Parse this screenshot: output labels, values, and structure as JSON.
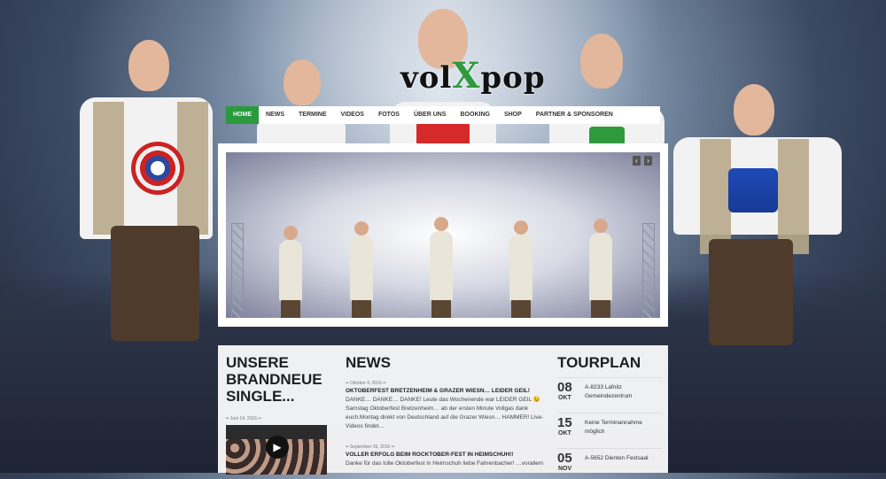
{
  "brand": {
    "logo_text_1": "vol",
    "logo_text_2": "X",
    "logo_text_3": "pop"
  },
  "nav": {
    "items": [
      "HOME",
      "NEWS",
      "TERMINE",
      "VIDEOS",
      "FOTOS",
      "ÜBER UNS",
      "BOOKING",
      "SHOP",
      "PARTNER & SPONSOREN"
    ],
    "active_index": 0
  },
  "slider": {
    "prev_label": "‹",
    "next_label": "›"
  },
  "single": {
    "title": "UNSERE BRANDNEUE SINGLE...",
    "date": "•• Juni 14, 2016 ••",
    "play_icon": "play-icon"
  },
  "news": {
    "title": "NEWS",
    "items": [
      {
        "date": "•• Oktober 4, 2016 ••",
        "headline": "OKTOBERFEST BRETZENHEIM & GRAZER WIESN… LEIDER GEIL!",
        "text": "DANKE… DANKE… DANKE! Leute das Wochenende war LEIDER GEIL 😉 Samstag Oktoberfest Bretzenheim… ab der ersten Minute Vollgas dank euch.Montag direkt von Deutschland auf die Grazer Wiesn… HAMMER! Live-Videos findet…"
      },
      {
        "date": "•• September 26, 2016 ••",
        "headline": "VOLLER ERFOLG BEIM ROCKTOBER-FEST IN HEIMSCHUH!!",
        "text": "Danke für das tolle Oktoberfest in Heimschuh liebe Fahrenbacher! …vorallem"
      }
    ]
  },
  "tour": {
    "title": "TOURPLAN",
    "items": [
      {
        "day": "08",
        "month": "OKT",
        "text": "A-8233 Lafnitz Gemeindezentrum"
      },
      {
        "day": "15",
        "month": "OKT",
        "text": "Keine Terminannahme möglich"
      },
      {
        "day": "05",
        "month": "NOV",
        "text": "A-5652 Dienten Festsaal"
      }
    ]
  }
}
